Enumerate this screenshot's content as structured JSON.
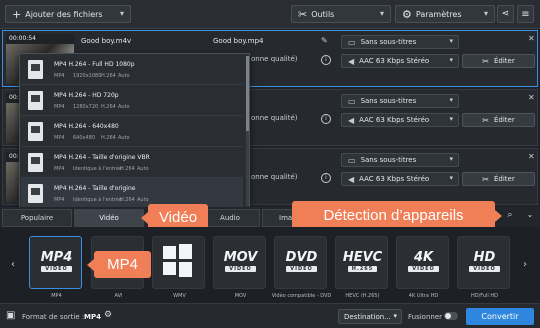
{
  "toolbar": {
    "add_label": "Ajouter des fichiers",
    "tools_label": "Outils",
    "params_label": "Paramètres"
  },
  "files": [
    {
      "duration": "00:00:54",
      "name": "Good boy.m4v",
      "output": "Good boy.mp4",
      "quality": "onne qualité)",
      "subtitles": "Sans sous-titres",
      "audio": "AAC 63 Kbps Stéréo",
      "edit_label": "Éditer"
    },
    {
      "duration": "00:00:54",
      "name": "",
      "output": "",
      "quality": "onne qualité)",
      "subtitles": "Sans sous-titres",
      "audio": "AAC 63 Kbps Stéréo",
      "edit_label": "Éditer"
    },
    {
      "duration": "00:00:54",
      "name": "",
      "output": "",
      "quality": "onne qualité)",
      "subtitles": "Sans sous-titres",
      "audio": "AAC 63 Kbps Stéréo",
      "edit_label": "Éditer"
    }
  ],
  "popup": {
    "items": [
      {
        "title": "MP4 H.264 - Full HD 1080p",
        "details": [
          "MP4",
          "1920x1080",
          "H.264",
          "Auto"
        ]
      },
      {
        "title": "MP4 H.264 - HD 720p",
        "details": [
          "MP4",
          "1280x720",
          "H.264",
          "Auto"
        ]
      },
      {
        "title": "MP4 H.264 - 640x480",
        "details": [
          "MP4",
          "640x480",
          "H.264",
          "Auto"
        ]
      },
      {
        "title": "MP4 H.264 - Taille d'origine VBR",
        "details": [
          "MP4",
          "Identique à l'entrée",
          "H.264",
          "Auto"
        ]
      },
      {
        "title": "MP4 H.264 - Taille d'origine",
        "details": [
          "MP4",
          "Identique à l'entrée",
          "H.264",
          "Auto"
        ]
      }
    ]
  },
  "tabs": {
    "popular": "Populaire",
    "video": "Vidéo",
    "audio": "Audio",
    "image": "Ima"
  },
  "callouts": {
    "video": "Vidéo",
    "devices": "Détection d’appareils",
    "mp4": "MP4"
  },
  "formats": [
    {
      "badge": "MP4",
      "sub": "VIDEO",
      "label": "MP4"
    },
    {
      "badge": "",
      "sub": "",
      "label": "AVI"
    },
    {
      "badge": "",
      "sub": "",
      "label": "WMV"
    },
    {
      "badge": "MOV",
      "sub": "VIDEO",
      "label": "MOV"
    },
    {
      "badge": "DVD",
      "sub": "VIDEO",
      "label": "Vidéo compatible - DVD"
    },
    {
      "badge": "HEVC",
      "sub": "H.265",
      "label": "HEVC (H.265)"
    },
    {
      "badge": "4K",
      "sub": "VIDEO",
      "label": "4K Ultra HD"
    },
    {
      "badge": "HD",
      "sub": "VIDEO",
      "label": "HD/Full HD"
    }
  ],
  "bottom": {
    "format_label": "Format de sortie :",
    "format_value": "MP4",
    "destination": "Destination...",
    "merge_label": "Fusionner :",
    "convert_label": "Convertir"
  },
  "colors": {
    "accent": "#2f86de",
    "callout": "#f07e56",
    "background": "#1f2327"
  }
}
